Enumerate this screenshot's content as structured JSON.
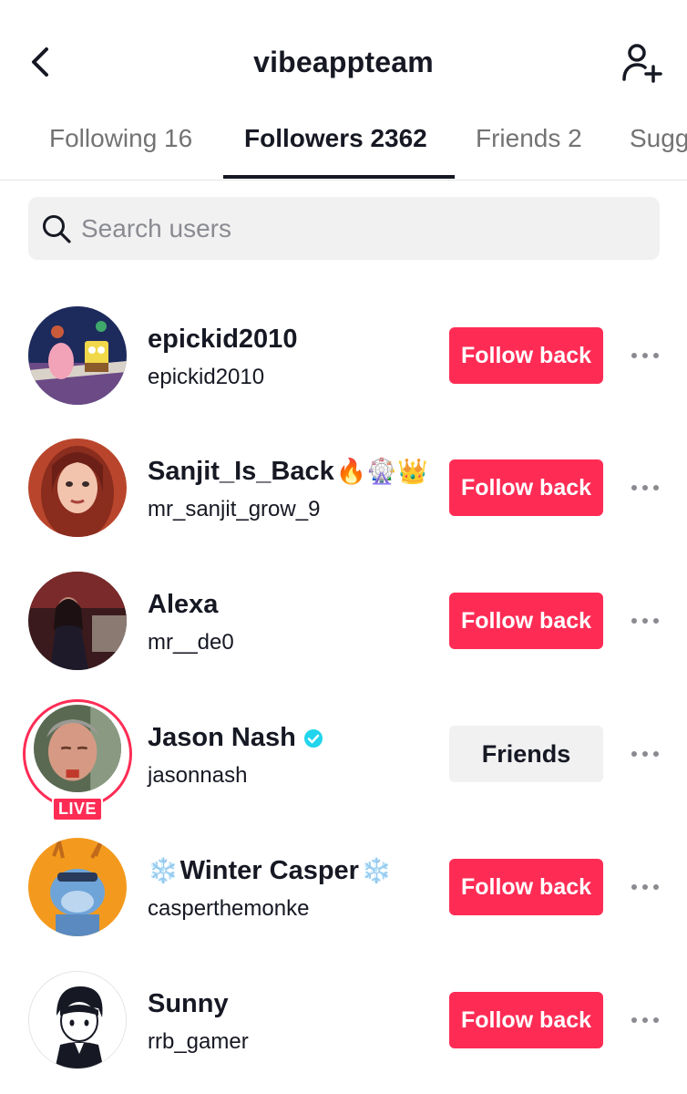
{
  "header": {
    "title": "vibeappteam",
    "back_icon": "chevron-left-icon",
    "add_user_icon": "add-user-icon"
  },
  "tabs": [
    {
      "label": "Following 16",
      "active": false
    },
    {
      "label": "Followers 2362",
      "active": true
    },
    {
      "label": "Friends 2",
      "active": false
    },
    {
      "label": "Sugg",
      "active": false
    }
  ],
  "search": {
    "placeholder": "Search users",
    "value": ""
  },
  "colors": {
    "accent": "#fe2c55",
    "text": "#161823",
    "muted": "#8a8b91",
    "surface": "#f1f1f2",
    "verified": "#20d5ec"
  },
  "followers": [
    {
      "name": "epickid2010",
      "handle": "epickid2010",
      "action": "Follow back",
      "live": false,
      "verified": false,
      "avatar": "avatar-cartoon-characters"
    },
    {
      "name": "Sanjit_Is_Back",
      "emoji_after": "🔥🎡👑",
      "handle": "mr_sanjit_grow_9",
      "action": "Follow back",
      "live": false,
      "verified": false,
      "avatar": "avatar-drawn-portrait"
    },
    {
      "name": "Alexa",
      "handle": "mr__de0",
      "action": "Follow back",
      "live": false,
      "verified": false,
      "avatar": "avatar-photo-night"
    },
    {
      "name": "Jason Nash",
      "handle": "jasonnash",
      "action": "Friends",
      "live": true,
      "live_label": "LIVE",
      "verified": true,
      "avatar": "avatar-photo-man"
    },
    {
      "name": "Winter Casper",
      "emoji_before": "❄️",
      "emoji_after": "❄️",
      "handle": "casperthemonke",
      "action": "Follow back",
      "live": false,
      "verified": false,
      "avatar": "avatar-cartoon-monkey"
    },
    {
      "name": "Sunny",
      "handle": "rrb_gamer",
      "action": "Follow back",
      "live": false,
      "verified": false,
      "avatar": "avatar-drawn-boy"
    }
  ]
}
